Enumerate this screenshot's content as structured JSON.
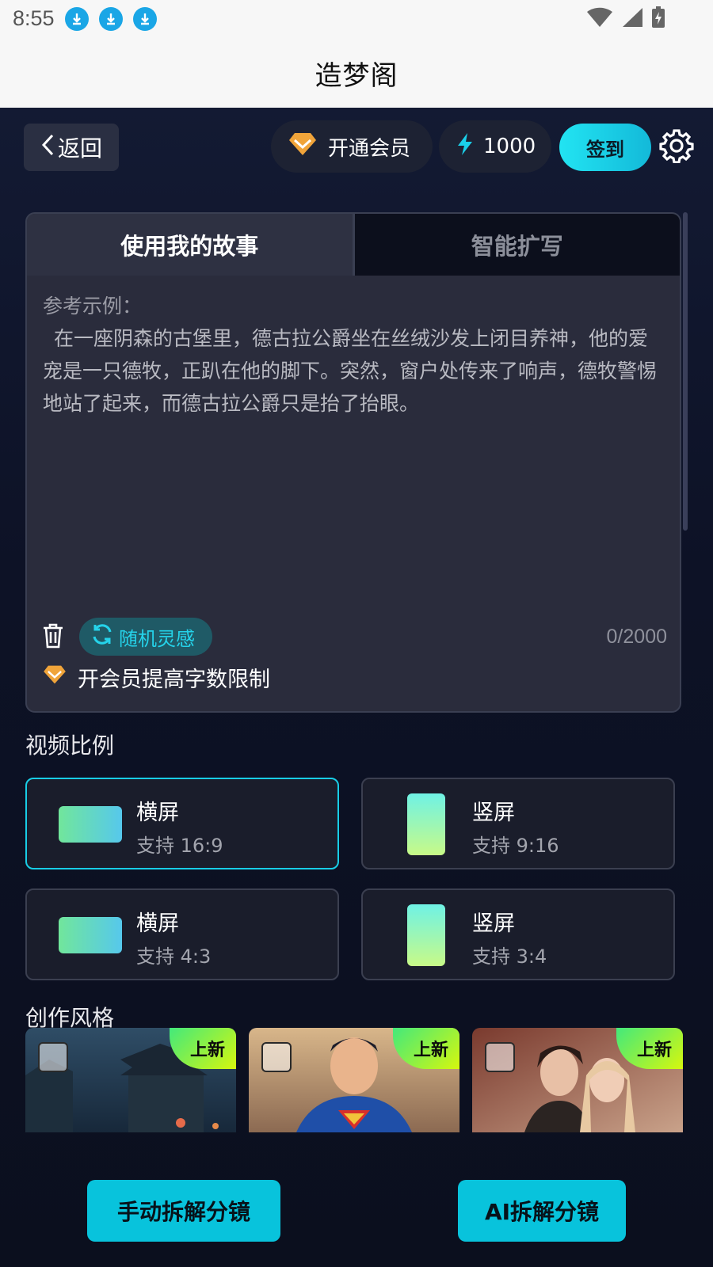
{
  "status_bar": {
    "time": "8:55"
  },
  "header": {
    "title": "造梦阁"
  },
  "topbar": {
    "back_label": "返回",
    "vip_label": "开通会员",
    "energy_value": "1000",
    "signin_label": "签到"
  },
  "story": {
    "tabs": [
      {
        "label": "使用我的故事",
        "active": true
      },
      {
        "label": "智能扩写",
        "active": false
      }
    ],
    "example_label": "参考示例：",
    "example_text": "在一座阴森的古堡里，德古拉公爵坐在丝绒沙发上闭目养神，他的爱宠是一只德牧，正趴在他的脚下。突然，窗户处传来了响声，德牧警惕地站了起来，而德古拉公爵只是抬了抬眼。",
    "random_label": "随机灵感",
    "counter": "0/2000",
    "vip_limit_label": "开会员提高字数限制"
  },
  "video_ratio": {
    "title": "视频比例",
    "options": [
      {
        "name": "横屏",
        "desc": "支持 16:9",
        "selected": true
      },
      {
        "name": "竖屏",
        "desc": "支持 9:16",
        "selected": false
      },
      {
        "name": "横屏",
        "desc": "支持 4:3",
        "selected": false
      },
      {
        "name": "竖屏",
        "desc": "支持 3:4",
        "selected": false
      }
    ]
  },
  "creation_style": {
    "title": "创作风格",
    "items": [
      {
        "badge": "上新",
        "selected": false
      },
      {
        "badge": "上新",
        "selected": false
      },
      {
        "badge": "上新",
        "selected": false
      }
    ]
  },
  "actions": {
    "manual_label": "手动拆解分镜",
    "ai_label": "AI拆解分镜"
  },
  "colors": {
    "accent": "#18cde6",
    "background": "#0b0f1e",
    "new_badge": "#43e97b"
  }
}
